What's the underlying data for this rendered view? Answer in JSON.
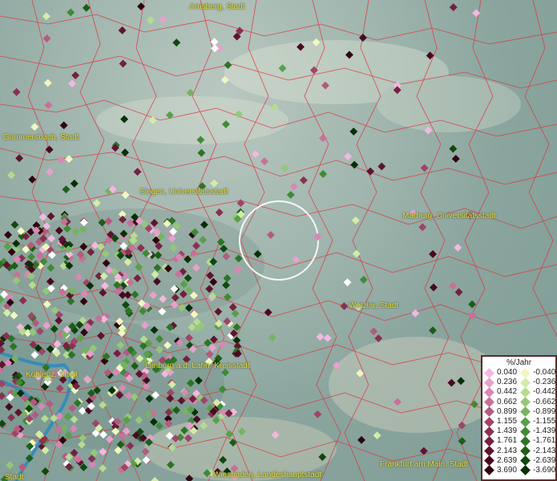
{
  "map": {
    "cities": [
      {
        "id": "arnsberg",
        "label": "Arnsberg, Stadt"
      },
      {
        "id": "gummersbach",
        "label": "Gummersbach, Stadt"
      },
      {
        "id": "siegen",
        "label": "Siegen, Universitätsstadt"
      },
      {
        "id": "marburg",
        "label": "Marburg, Universitätsstadt"
      },
      {
        "id": "wetzlar",
        "label": "Wetzlar, Stadt"
      },
      {
        "id": "limburg",
        "label": "Limburg a.d. Lahn, Kreisstadt"
      },
      {
        "id": "koblenz",
        "label": "Koblenz, Stadt"
      },
      {
        "id": "frankfurt",
        "label": "Frankfurt am Main, Stadt"
      },
      {
        "id": "wiesbaden",
        "label": "Wiesbaden, Landeshauptstadt"
      },
      {
        "id": "stadt-sw",
        "label": "Stadt"
      }
    ],
    "colors": {
      "boundary": "#e0303a",
      "water": "#2a8ac0",
      "city_label": "#e6e04a"
    }
  },
  "legend": {
    "title": "%/Jahr",
    "positive": [
      {
        "label": "0.040",
        "color": "#f4b8e0"
      },
      {
        "label": "0.236",
        "color": "#e8a0cc"
      },
      {
        "label": "0.442",
        "color": "#d888b4"
      },
      {
        "label": "0.662",
        "color": "#c87098"
      },
      {
        "label": "0.899",
        "color": "#b45a80"
      },
      {
        "label": "1.155",
        "color": "#a04468"
      },
      {
        "label": "1.439",
        "color": "#8a3050"
      },
      {
        "label": "1.761",
        "color": "#74203e"
      },
      {
        "label": "2.143",
        "color": "#5e142e"
      },
      {
        "label": "2.639",
        "color": "#480a20"
      },
      {
        "label": "3.690",
        "color": "#300410"
      }
    ],
    "negative": [
      {
        "label": "-0.040",
        "color": "#f0f8c0"
      },
      {
        "label": "-0.236",
        "color": "#d4eca8"
      },
      {
        "label": "-0.442",
        "color": "#b4dc90"
      },
      {
        "label": "-0.662",
        "color": "#94c878"
      },
      {
        "label": "-0.899",
        "color": "#74b460"
      },
      {
        "label": "-1.155",
        "color": "#58a04a"
      },
      {
        "label": "-1.439",
        "color": "#408a36"
      },
      {
        "label": "-1.761",
        "color": "#2c7426"
      },
      {
        "label": "-2.143",
        "color": "#1c5e18"
      },
      {
        "label": "-2.639",
        "color": "#10480e"
      },
      {
        "label": "-3.690",
        "color": "#083006"
      }
    ]
  }
}
